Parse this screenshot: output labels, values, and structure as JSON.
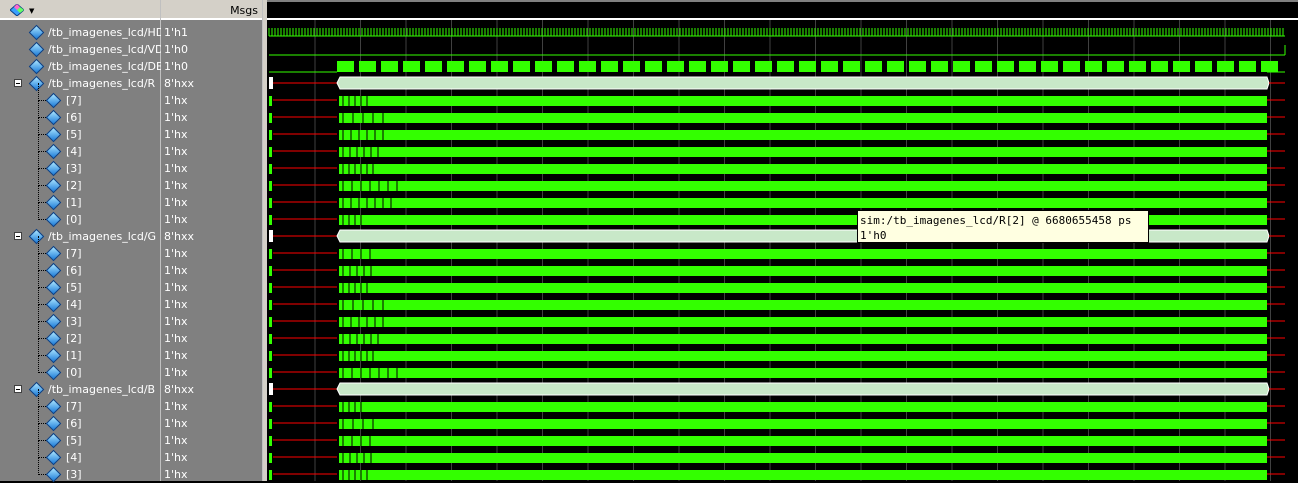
{
  "header": {
    "msgs_label": "Msgs"
  },
  "signals": [
    {
      "name": "/tb_imagenes_lcd/HD",
      "value": "1'h1",
      "kind": "top"
    },
    {
      "name": "/tb_imagenes_lcd/VD",
      "value": "1'h0",
      "kind": "top"
    },
    {
      "name": "/tb_imagenes_lcd/DEN",
      "value": "1'h0",
      "kind": "top"
    },
    {
      "name": "/tb_imagenes_lcd/R",
      "value": "8'hxx",
      "kind": "bus"
    },
    {
      "name": "[7]",
      "value": "1'hx",
      "kind": "bit"
    },
    {
      "name": "[6]",
      "value": "1'hx",
      "kind": "bit"
    },
    {
      "name": "[5]",
      "value": "1'hx",
      "kind": "bit"
    },
    {
      "name": "[4]",
      "value": "1'hx",
      "kind": "bit"
    },
    {
      "name": "[3]",
      "value": "1'hx",
      "kind": "bit"
    },
    {
      "name": "[2]",
      "value": "1'hx",
      "kind": "bit"
    },
    {
      "name": "[1]",
      "value": "1'hx",
      "kind": "bit"
    },
    {
      "name": "[0]",
      "value": "1'hx",
      "kind": "bit"
    },
    {
      "name": "/tb_imagenes_lcd/G",
      "value": "8'hxx",
      "kind": "bus"
    },
    {
      "name": "[7]",
      "value": "1'hx",
      "kind": "bit"
    },
    {
      "name": "[6]",
      "value": "1'hx",
      "kind": "bit"
    },
    {
      "name": "[5]",
      "value": "1'hx",
      "kind": "bit"
    },
    {
      "name": "[4]",
      "value": "1'hx",
      "kind": "bit"
    },
    {
      "name": "[3]",
      "value": "1'hx",
      "kind": "bit"
    },
    {
      "name": "[2]",
      "value": "1'hx",
      "kind": "bit"
    },
    {
      "name": "[1]",
      "value": "1'hx",
      "kind": "bit"
    },
    {
      "name": "[0]",
      "value": "1'hx",
      "kind": "bit"
    },
    {
      "name": "/tb_imagenes_lcd/B",
      "value": "8'hxx",
      "kind": "bus"
    },
    {
      "name": "[7]",
      "value": "1'hx",
      "kind": "bit"
    },
    {
      "name": "[6]",
      "value": "1'hx",
      "kind": "bit"
    },
    {
      "name": "[5]",
      "value": "1'hx",
      "kind": "bit"
    },
    {
      "name": "[4]",
      "value": "1'hx",
      "kind": "bit"
    },
    {
      "name": "[3]",
      "value": "1'hx",
      "kind": "bit"
    }
  ],
  "tooltip": {
    "line1": "sim:/tb_imagenes_lcd/R[2] @ 6680655458 ps",
    "line2": "1'h0"
  },
  "colors": {
    "wave_green": "#33ff00",
    "unknown_red": "#ff0000",
    "bus_fill": "#c8e8c8",
    "grid": "#404040"
  },
  "icons": {
    "selector": "diamond-selector-icon",
    "signal": "diamond-signal-icon",
    "collapse": "minus-box-icon"
  }
}
